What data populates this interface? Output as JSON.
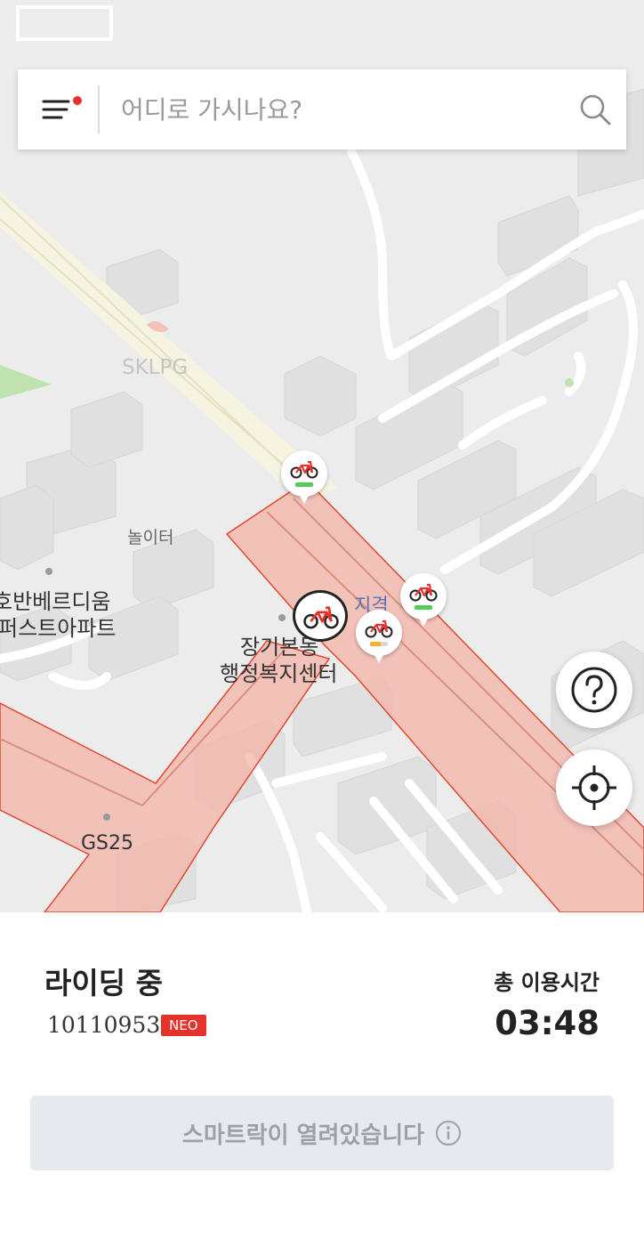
{
  "search": {
    "placeholder": "어디로 가시나요?"
  },
  "map": {
    "labels": {
      "sklpg": "SKLPG",
      "playground": "놀이터",
      "apartment_line1": "호반베르디움",
      "apartment_line2": "퍼스트아파트",
      "community_center_line1": "장기본동",
      "community_center_line2": "행정복지센터",
      "area": "지격",
      "gs25": "GS25"
    },
    "pins": [
      {
        "battery": "full",
        "color": "#55c95a"
      },
      {
        "battery": "full",
        "color": "#55c95a"
      },
      {
        "battery": "low",
        "color": "#f2b32f"
      }
    ],
    "zone_color": "#f4b3a7",
    "zone_border": "#e04a2f"
  },
  "buttons": {
    "help_icon": "question-icon",
    "locate_icon": "crosshair-icon"
  },
  "ride": {
    "status": "라이딩 중",
    "bike_id": "10110953",
    "badge": "NEO",
    "time_label": "총 이용시간",
    "time_value": "03:48"
  },
  "smartlock": {
    "label": "스마트락이 열려있습니다"
  },
  "colors": {
    "accent": "#e5322b"
  }
}
